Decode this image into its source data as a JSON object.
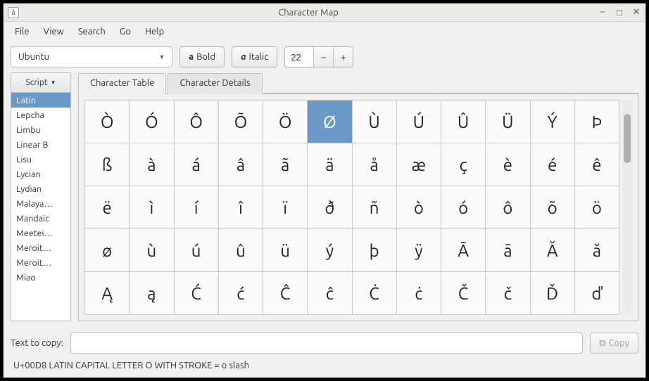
{
  "window": {
    "title": "Character Map",
    "app_icon_glyph": "â"
  },
  "menu": {
    "items": [
      "File",
      "View",
      "Search",
      "Go",
      "Help"
    ]
  },
  "toolbar": {
    "font_name": "Ubuntu",
    "bold_label": "Bold",
    "italic_label": "Italic",
    "font_size": "22"
  },
  "sidebar": {
    "header": "Script",
    "items": [
      "Latin",
      "Lepcha",
      "Limbu",
      "Linear B",
      "Lisu",
      "Lycian",
      "Lydian",
      "Malaya…",
      "Mandaic",
      "Meetei…",
      "Meroit…",
      "Meroit…",
      "Miao"
    ],
    "selected_index": 0
  },
  "tabs": {
    "items": [
      "Character Table",
      "Character Details"
    ],
    "active_index": 0
  },
  "chart_data": {
    "type": "table",
    "columns": 12,
    "rows": 5,
    "selected_index": 5,
    "cells": [
      "Ò",
      "Ó",
      "Ô",
      "Õ",
      "Ö",
      "Ø",
      "Ù",
      "Ú",
      "Û",
      "Ü",
      "Ý",
      "Þ",
      "ß",
      "à",
      "á",
      "â",
      "ã",
      "ä",
      "å",
      "æ",
      "ç",
      "è",
      "é",
      "ê",
      "ë",
      "ì",
      "í",
      "î",
      "ï",
      "ð",
      "ñ",
      "ò",
      "ó",
      "ô",
      "õ",
      "ö",
      "ø",
      "ù",
      "ú",
      "û",
      "ü",
      "ý",
      "þ",
      "ÿ",
      "Ā",
      "ā",
      "Ă",
      "ă",
      "Ą",
      "ą",
      "Ć",
      "ć",
      "Ĉ",
      "ĉ",
      "Ċ",
      "ċ",
      "Č",
      "č",
      "Ď",
      "ď"
    ]
  },
  "bottom": {
    "label": "Text to copy:",
    "value": "",
    "copy_label": "Copy"
  },
  "status": {
    "text": "U+00D8 LATIN CAPITAL LETTER O WITH STROKE   = o slash"
  }
}
